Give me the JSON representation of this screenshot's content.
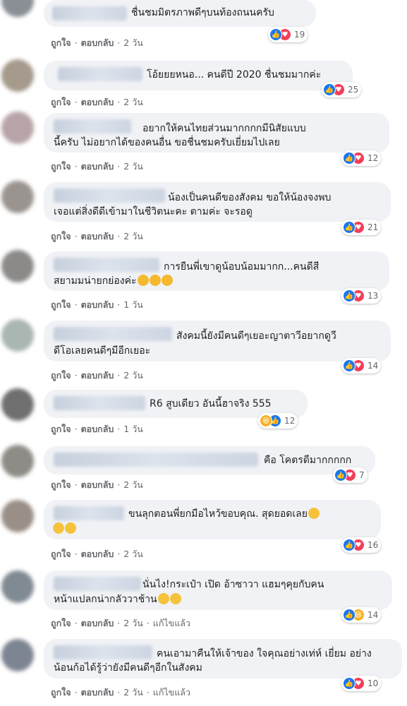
{
  "labels": {
    "like": "ถูกใจ",
    "reply": "ตอบกลับ",
    "dot": "·",
    "edited": "แก้ไขแล้ว"
  },
  "comments": [
    {
      "lines": [
        "ชื่นชมมิตรภาพดีๆบนท้องถนนครับ"
      ],
      "reactions": [
        "like",
        "love"
      ],
      "count": "19",
      "time": "2 วัน",
      "edited": false
    },
    {
      "lines": [
        "โอ้ยยยหนอ... คนดีปี 2020 ชื่นชมมากค่ะ"
      ],
      "reactions": [
        "like",
        "love"
      ],
      "count": "25",
      "time": "2 วัน",
      "edited": false
    },
    {
      "lines": [
        "อยากให้คนไทยส่วนมากกกกมีนิสัยแบบ",
        "นี้ครับ ไม่อยากได้ของคนอื่น ขอชื่นชมครับเยี่ยมไปเลย"
      ],
      "reactions": [
        "like",
        "love"
      ],
      "count": "12",
      "time": "2 วัน",
      "edited": false
    },
    {
      "lines": [
        "น้องเป็นคนดีของสังคม ขอให้น้องจงพบ",
        "เจอแต่สิ่งดีดีเข้ามาในชีวิตนะคะ ตามค่ะ จะรอดู"
      ],
      "reactions": [
        "like",
        "love"
      ],
      "count": "21",
      "time": "2 วัน",
      "edited": false
    },
    {
      "lines": [
        "การยืนพี่เขาดูน้อบน้อมมากก...คนดีสี",
        "สยามมน่ายกย่องค่ะ"
      ],
      "reactions": [
        "like",
        "love"
      ],
      "count": "13",
      "time": "1 วัน",
      "edited": false
    },
    {
      "lines": [
        "สังคมนี้ยังมีคนดีๆเยอะญาตาวีอยากดูวี",
        "ดีโอเลยคนดีๆมีอีกเยอะ"
      ],
      "reactions": [
        "like",
        "love"
      ],
      "count": "14",
      "time": "2 วัน",
      "edited": false
    },
    {
      "lines": [
        "R6 สูบเดียว อันนี้ฮาจริง 555"
      ],
      "reactions": [
        "haha",
        "like"
      ],
      "count": "12",
      "time": "1 วัน",
      "edited": false
    },
    {
      "lines": [
        "คือ โคตรดีมากกกกก"
      ],
      "reactions": [
        "like",
        "love"
      ],
      "count": "7",
      "time": "2 วัน",
      "edited": false
    },
    {
      "lines": [
        "ขนลุกตอนพี่ยกมือไหว้ขอบคุณ. สุดยอดเลย"
      ],
      "reactions": [
        "like",
        "love"
      ],
      "count": "16",
      "time": "2 วัน",
      "edited": false
    },
    {
      "lines": [
        "นั่นไง!กระเป๋า เปิด อ้าซาวา แฮมๆคุยกับคน",
        "หน้าแปลกน่ากลัววาช้าน"
      ],
      "reactions": [
        "like",
        "haha"
      ],
      "count": "14",
      "time": "2 วัน",
      "edited": true
    },
    {
      "lines": [
        "คนเอามาคืนให้เจ้าของ ใจคุณอย่างเท่ห์ เยี่ยม อย่าง",
        "น้อนก้อได้รู้ว่ายังมีคนดีๆอีกในสังคม"
      ],
      "reactions": [
        "like",
        "love"
      ],
      "count": "10",
      "time": "2 วัน",
      "edited": true
    }
  ]
}
